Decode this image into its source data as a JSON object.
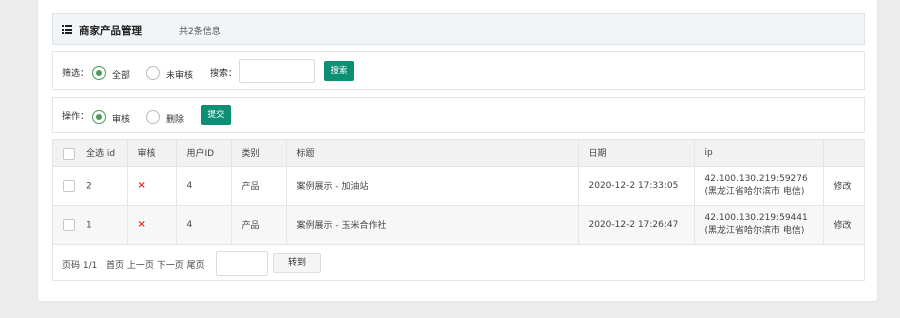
{
  "header": {
    "title": "商家产品管理",
    "count": "共2条信息"
  },
  "filter": {
    "label": "筛选：",
    "options": [
      {
        "label": "全部",
        "selected": true
      },
      {
        "label": "未审核",
        "selected": false
      }
    ],
    "search_label": "搜索：",
    "search_value": "",
    "search_button": "搜索"
  },
  "actions": {
    "label": "操作：",
    "options": [
      {
        "label": "审核",
        "selected": true
      },
      {
        "label": "删除",
        "selected": false
      }
    ],
    "submit_button": "提交"
  },
  "table": {
    "columns": [
      "全选 id",
      "审核",
      "用户ID",
      "类别",
      "标题",
      "日期",
      "ip",
      ""
    ],
    "rows": [
      {
        "id": "2",
        "audit": "×",
        "user_id": "4",
        "category": "产品",
        "title": "案例展示 - 加油站",
        "date": "2020-12-2 17:33:05",
        "ip": "42.100.130.219:59276",
        "location": "(黑龙江省哈尔滨市 电信)",
        "action": "修改"
      },
      {
        "id": "1",
        "audit": "×",
        "user_id": "4",
        "category": "产品",
        "title": "案例展示 - 玉米合作社",
        "date": "2020-12-2 17:26:47",
        "ip": "42.100.130.219:59441",
        "location": "(黑龙江省哈尔滨市 电信)",
        "action": "修改"
      }
    ]
  },
  "pager": {
    "page_info": "页码 1/1",
    "nav": "首页 上一页 下一页 尾页",
    "page_input": "",
    "goto_button": "转到"
  },
  "colors": {
    "accent": "#0d8f73",
    "radio_checked": "#4a9a5c",
    "reject_mark": "#d9342b"
  }
}
